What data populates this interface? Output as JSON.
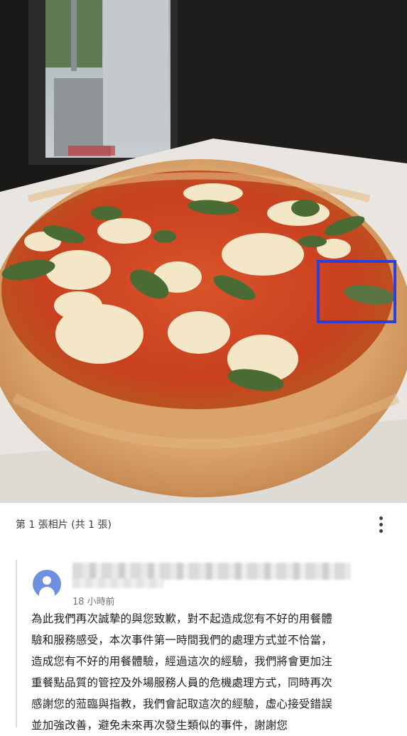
{
  "photo": {
    "subject": "margherita pizza with basil, tomato sauce and melted mozzarella",
    "highlight_color": "#2f3ed6"
  },
  "caption_bar": {
    "counter_text": "第 1 張相片 (共 1 張)",
    "more_icon": "more-vert-icon"
  },
  "reply": {
    "avatar_icon": "person-icon",
    "avatar_color": "#6f8fe0",
    "time": "18 小時前",
    "text": "為此我們再次誠摯的與您致歉，對不起造成您有不好的用餐體\n驗和服務感受，本次事件第一時間我們的處理方式並不恰當，\n造成您有不好的用餐體驗，經過這次的經驗，我們將會更加注\n重餐點品質的管控及外場服務人員的危機處理方式，同時再次\n感謝您的蒞臨與指教，我們會記取這次的經驗，虛心接受錯誤\n並加強改善，避免未來再次發生類似的事件，謝謝您"
  }
}
